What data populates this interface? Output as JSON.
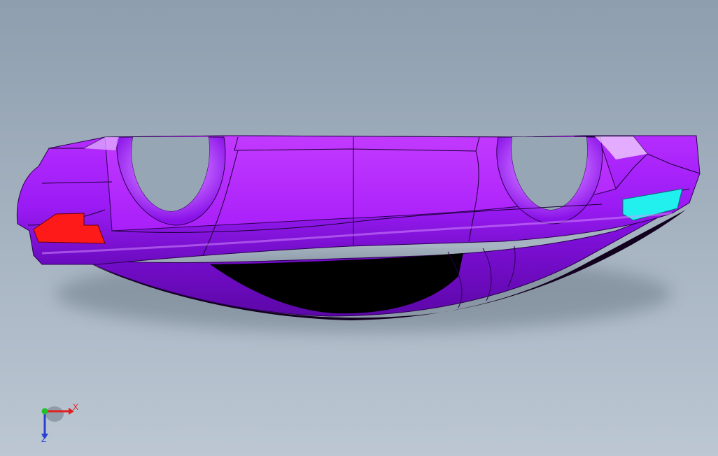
{
  "viewport": {
    "background_top": "#8e9eae",
    "background_bottom": "#bcc7d3"
  },
  "model": {
    "body_color": "#9b1bf5",
    "body_highlight": "#c040ff",
    "body_shadow": "#6a0bbf",
    "opening_color": "#000000",
    "left_face_color": "#ff1a1a",
    "right_face_color": "#22f0ee",
    "edge_color": "#1a0033"
  },
  "triad": {
    "x_label": "X",
    "z_label": "Z",
    "x_color": "#e02020",
    "z_color": "#2a3fd0",
    "y_color": "#22c02a"
  }
}
